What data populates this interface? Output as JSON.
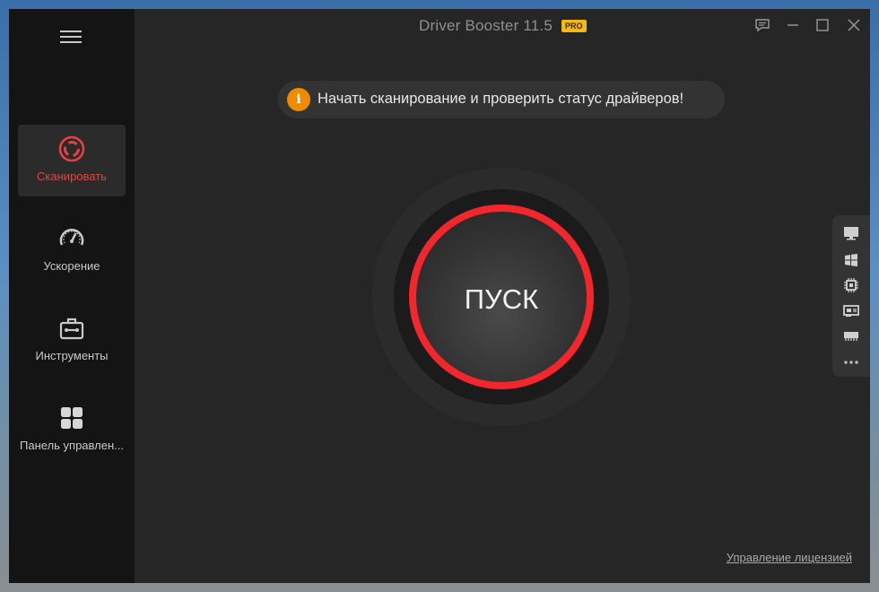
{
  "app": {
    "title": "Driver Booster 11.5",
    "badge": "PRO"
  },
  "window_controls": {
    "feedback": "feedback-icon",
    "minimize": "minimize-icon",
    "maximize": "maximize-icon",
    "close": "close-icon"
  },
  "sidebar": {
    "menu_icon": "hamburger-menu-icon",
    "items": [
      {
        "label": "Сканировать",
        "icon": "scan-icon",
        "active": true
      },
      {
        "label": "Ускорение",
        "icon": "speedometer-icon",
        "active": false
      },
      {
        "label": "Инструменты",
        "icon": "toolbox-icon",
        "active": false
      },
      {
        "label": "Панель управлен...",
        "icon": "dashboard-icon",
        "active": false
      }
    ]
  },
  "banner": {
    "icon": "info-icon",
    "icon_glyph": "i",
    "text": "Начать сканирование и проверить статус драйверов!"
  },
  "scan_button": {
    "label": "ПУСК"
  },
  "right_toolbar": {
    "icons": [
      "monitor-icon",
      "windows-icon",
      "chip-icon",
      "network-card-icon",
      "memory-icon",
      "more-icon"
    ]
  },
  "footer": {
    "license_link": "Управление лицензией"
  },
  "colors": {
    "accent_red": "#f2262c",
    "info_orange": "#f08a00",
    "pro_badge": "#f3b817",
    "window_bg": "#262626",
    "sidebar_bg": "#141414"
  }
}
